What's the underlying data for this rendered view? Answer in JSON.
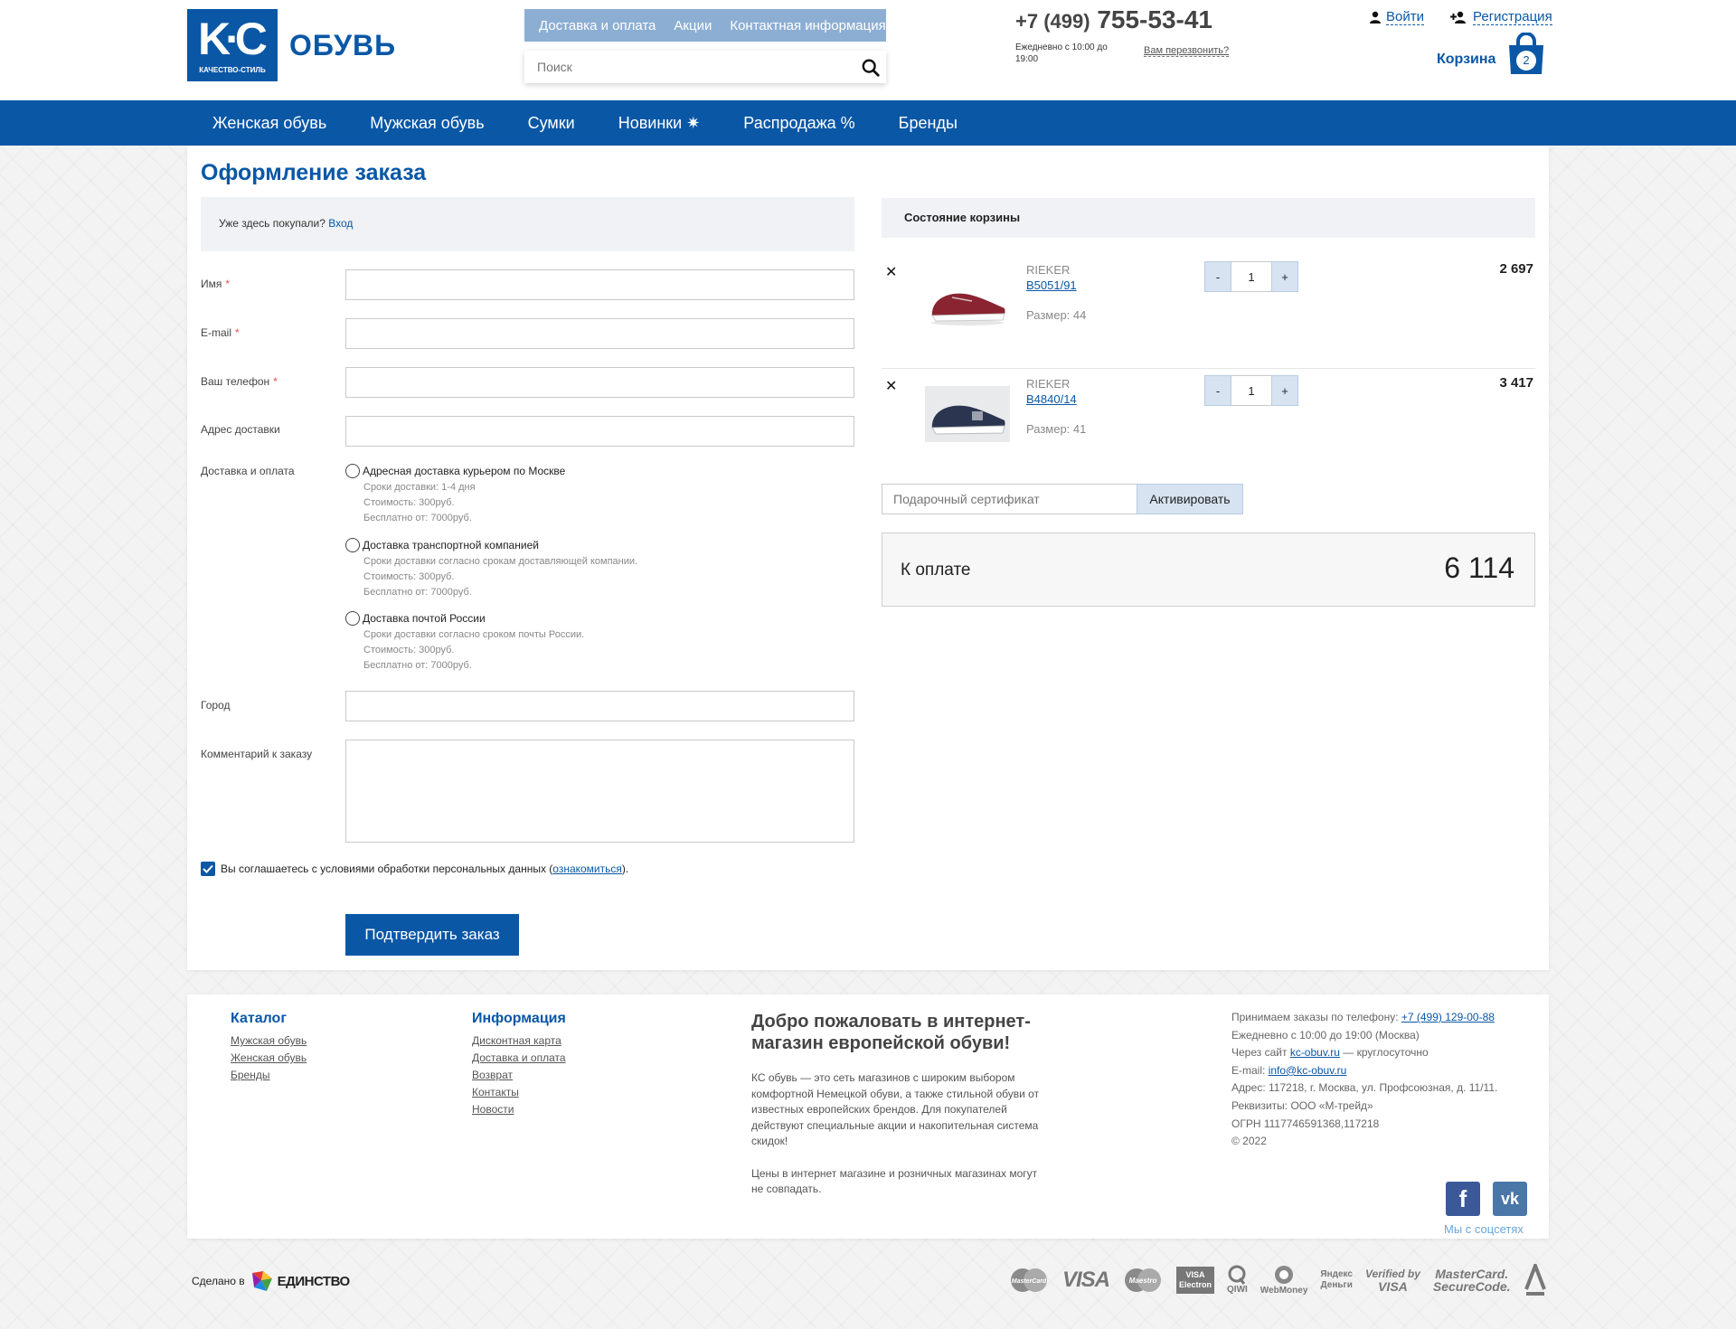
{
  "header": {
    "logo_mark": "K·C",
    "logo_sub": "КАЧЕСТВО-СТИЛЬ",
    "logo_word": "ОБУВЬ",
    "top_links": [
      "Доставка и оплата",
      "Акции",
      "Контактная информация"
    ],
    "search_placeholder": "Поиск",
    "phone_code": "+7 (499)",
    "phone_number": "755-53-41",
    "hours": "Ежедневно с 10:00 до 19:00",
    "callback": "Вам перезвонить?",
    "login": "Войти",
    "register": "Регистрация",
    "cart_label": "Корзина",
    "cart_count": "2"
  },
  "nav": {
    "items": [
      "Женская обувь",
      "Мужская обувь",
      "Сумки",
      "Новинки ✷",
      "Распродажа %",
      "Бренды"
    ]
  },
  "checkout": {
    "title": "Оформление заказа",
    "already_text": "Уже здесь покупали?",
    "already_link": "Вход",
    "fields": {
      "name": "Имя",
      "email": "E-mail",
      "phone": "Ваш телефон",
      "address": "Адрес доставки",
      "delivery": "Доставка и оплата",
      "city": "Город",
      "comment": "Комментарий к заказу",
      "required_mark": "*"
    },
    "delivery_options": [
      {
        "title": "Адресная доставка курьером по Москве",
        "lines": [
          "Сроки доставки: 1-4 дня",
          "Стоимость: 300руб.",
          "Бесплатно от: 7000руб."
        ]
      },
      {
        "title": "Доставка транспортной компанией",
        "lines": [
          "Сроки доставки согласно срокам доставляющей компании.",
          "Стоимость: 300руб.",
          "Бесплатно от: 7000руб."
        ]
      },
      {
        "title": "Доставка почтой России",
        "lines": [
          "Сроки доставки согласно сроком почты России.",
          "Стоимость: 300руб.",
          "Бесплатно от: 7000руб."
        ]
      }
    ],
    "consent_text": "Вы соглашаетесь с условиями обработки персональных данных (",
    "consent_link": "ознакомиться",
    "consent_end": ").",
    "submit": "Подтвердить заказ"
  },
  "cart": {
    "title": "Состояние корзины",
    "remove_glyph": "✕",
    "items": [
      {
        "brand": "RIEKER",
        "sku": "B5051/91",
        "size": "Размер: 44",
        "qty": "1",
        "price": "2 697",
        "shoe_color": "#8a2430"
      },
      {
        "brand": "RIEKER",
        "sku": "B4840/14",
        "size": "Размер: 41",
        "qty": "1",
        "price": "3 417",
        "shoe_color": "#2b3550"
      }
    ],
    "minus": "-",
    "plus": "+",
    "certificate_placeholder": "Подарочный сертификат",
    "activate": "Активировать",
    "total_label": "К оплате",
    "total_sum": "6 114"
  },
  "footer": {
    "catalog_title": "Каталог",
    "catalog_links": [
      "Мужская обувь",
      "Женская обувь",
      "Бренды"
    ],
    "info_title": "Информация",
    "info_links": [
      "Дисконтная карта",
      "Доставка и оплата",
      "Возврат",
      "Контакты",
      "Новости"
    ],
    "welcome_title": "Добро пожаловать в интернет-магазин европейской обуви!",
    "welcome_p1": "КС обувь — это сеть магазинов с широким выбором комфортной Немецкой обуви, а также стильной обуви от известных европейских брендов. Для покупателей действуют специальные акции и накопительная система скидок!",
    "welcome_p2": "Цены в интернет магазине и розничных магазинах могут не совпадать.",
    "contacts": {
      "orders_text": "Принимаем заказы по телефону:",
      "orders_phone": "+7 (499) 129-00-88",
      "hours": "Ежедневно с 10:00 до 19:00 (Москва)",
      "site_prefix": "Через сайт",
      "site": "kc-obuv.ru",
      "site_suffix": "— круглосуточно",
      "email_prefix": "E-mail:",
      "email": "info@kc-obuv.ru",
      "address": "Адрес: 117218, г. Москва, ул. Профсоюзная, д. 11/11.",
      "requisites": "Реквизиты: ООО «М-трейд»",
      "ogrn": "ОГРН 1117746591368,117218",
      "copyright": "© 2022"
    },
    "social_caption": "Мы с соцсетях",
    "social_fb": "f",
    "social_vk": "vk",
    "made_in": "Сделано в",
    "made_by": "ЕДИНСТВО",
    "payments": {
      "mastercard": "MasterCard",
      "visa": "VISA",
      "maestro": "Maestro",
      "visa_electron_1": "VISA",
      "visa_electron_2": "Electron",
      "qiwi": "QIWI",
      "webmoney": "WebMoney",
      "yandex_1": "Яндекс",
      "yandex_2": "Деньги",
      "verified_1": "Verified by",
      "verified_2": "VISA",
      "securecode_1": "MasterCard.",
      "securecode_2": "SecureCode."
    }
  }
}
